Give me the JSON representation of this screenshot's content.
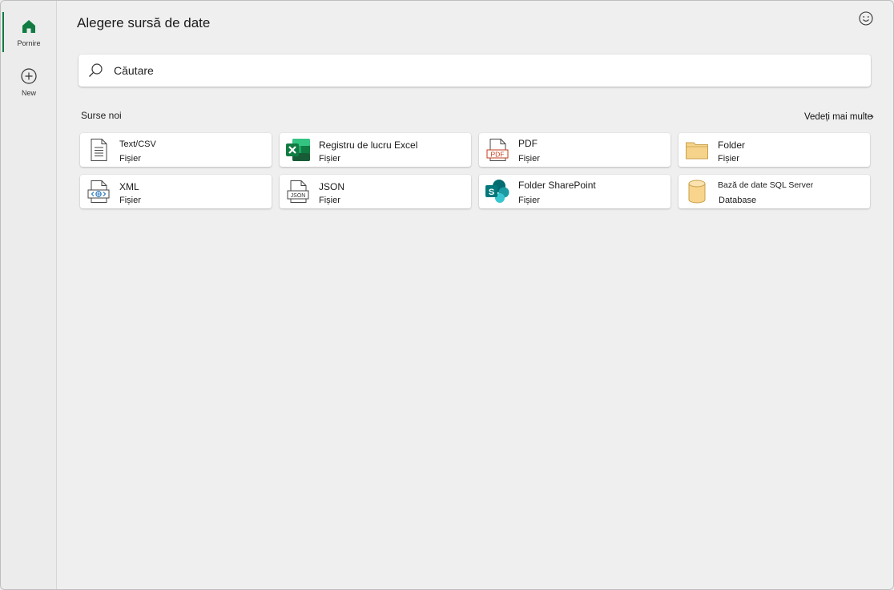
{
  "title": "Alegere sursă de date",
  "rail": {
    "home_label": "Pornire",
    "new_label": "New"
  },
  "search": {
    "placeholder": "Căutare"
  },
  "section": {
    "label": "Surse noi",
    "see_more": "Vedeți mai multe"
  },
  "cards": [
    {
      "name": "Text/CSV",
      "type": "Fișier",
      "icon": "text-file-icon"
    },
    {
      "name": "Registru de lucru Excel",
      "type": "Fișier",
      "icon": "excel-icon"
    },
    {
      "name": "PDF",
      "type": "Fișier",
      "icon": "pdf-icon"
    },
    {
      "name": "Folder",
      "type": "Fișier",
      "icon": "folder-icon"
    },
    {
      "name": "XML",
      "type": "Fișier",
      "icon": "xml-icon"
    },
    {
      "name": "JSON",
      "type": "Fișier",
      "icon": "json-icon"
    },
    {
      "name": "Folder SharePoint",
      "type": "Fișier",
      "icon": "sharepoint-icon"
    },
    {
      "name": "Bază de date SQL Server",
      "type": "Database",
      "icon": "database-icon"
    }
  ],
  "colors": {
    "accent": "#107c41",
    "background": "#efefef",
    "card": "#ffffff"
  }
}
